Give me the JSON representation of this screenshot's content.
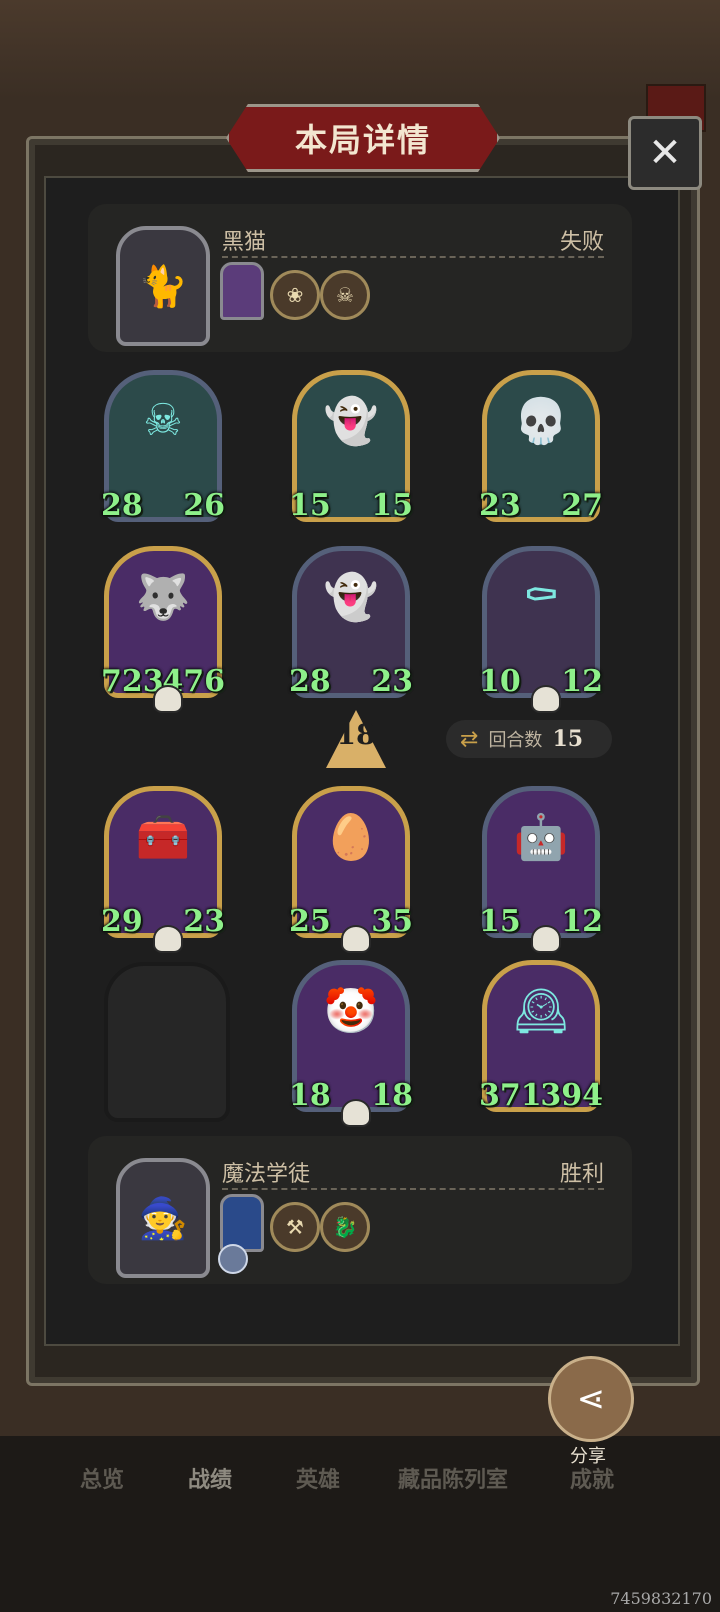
{
  "title": "本局详情",
  "close_icon": "close-icon",
  "players": [
    {
      "name": "黑猫",
      "result": "失败",
      "portrait_icon": "black-cat-icon"
    },
    {
      "name": "魔法学徒",
      "result": "胜利",
      "portrait_icon": "apprentice-icon"
    }
  ],
  "tier": "18",
  "turns": {
    "label": "回合数",
    "value": "15"
  },
  "enemy_cards": [
    {
      "atk": "28",
      "hp": "26"
    },
    {
      "atk": "15",
      "hp": "15"
    },
    {
      "atk": "23",
      "hp": "27"
    },
    {
      "atk": "723",
      "hp": "476"
    },
    {
      "atk": "28",
      "hp": "23"
    },
    {
      "atk": "10",
      "hp": "12"
    }
  ],
  "ally_cards": [
    {
      "atk": "29",
      "hp": "23"
    },
    {
      "atk": "25",
      "hp": "35"
    },
    {
      "atk": "15",
      "hp": "12"
    },
    {
      "atk": "18",
      "hp": "18"
    },
    {
      "atk": "371",
      "hp": "394"
    }
  ],
  "share": {
    "label": "分享"
  },
  "nav": [
    "总览",
    "战绩",
    "英雄",
    "藏品陈列室",
    "成就"
  ],
  "user_id": "7459832170"
}
